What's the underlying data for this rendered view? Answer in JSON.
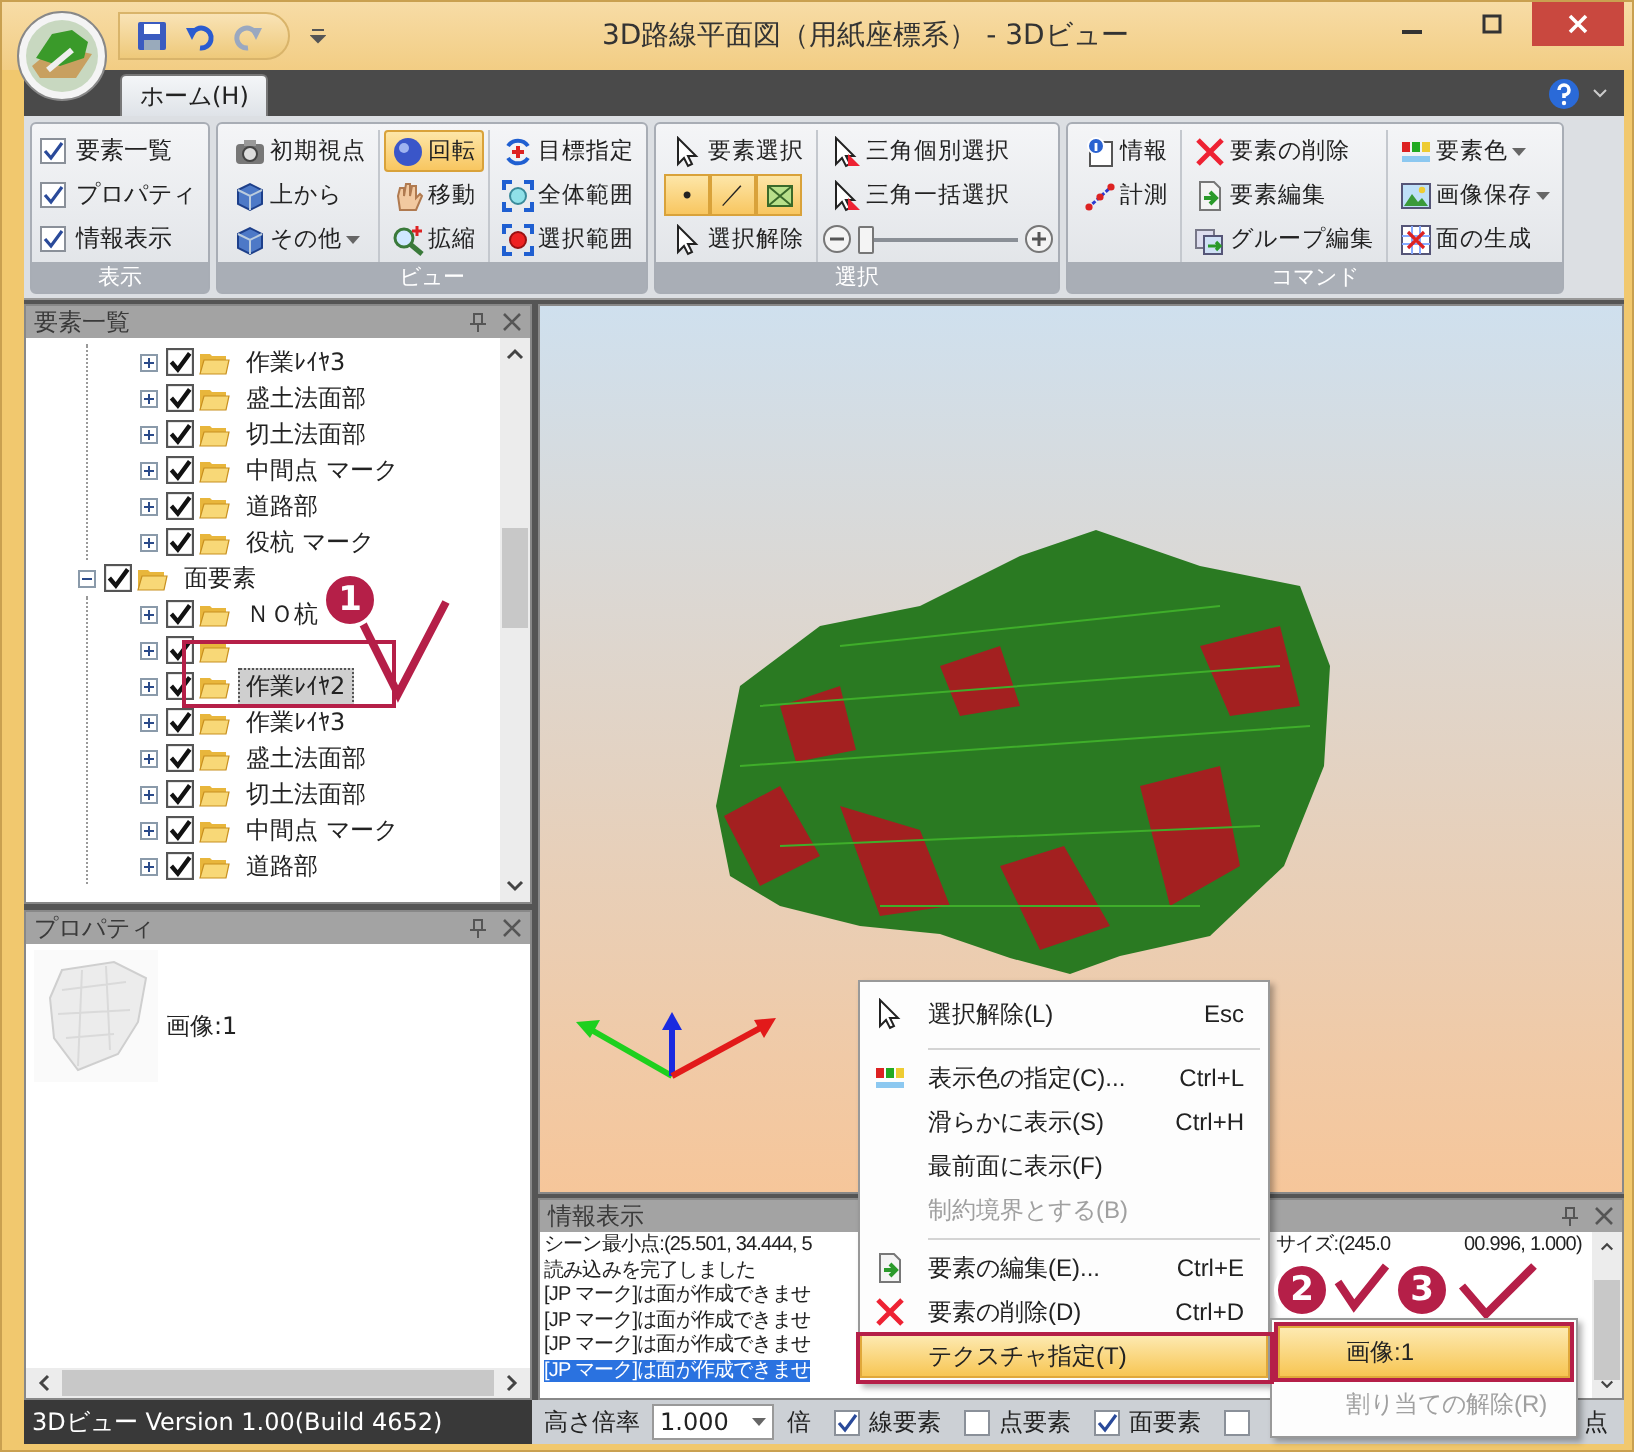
{
  "window": {
    "title": "3D路線平面図（用紙座標系） - 3Dビュー"
  },
  "tabs": [
    {
      "label": "ホーム(H)",
      "selected": true
    }
  ],
  "ribbon": {
    "groups": [
      {
        "title": "表示",
        "columns": [
          [
            {
              "kind": "check",
              "label": "要素一覧",
              "checked": true
            },
            {
              "kind": "check",
              "label": "プロパティ",
              "checked": true
            },
            {
              "kind": "check",
              "label": "情報表示",
              "checked": true
            }
          ]
        ]
      },
      {
        "title": "ビュー",
        "columns": [
          [
            {
              "kind": "button",
              "label": "初期視点",
              "selected": false
            },
            {
              "kind": "button",
              "label": "上から",
              "selected": false
            },
            {
              "kind": "button",
              "label": "その他",
              "selected": false,
              "dropdown": true
            }
          ],
          [
            {
              "kind": "button",
              "label": "回転",
              "selected": true
            },
            {
              "kind": "button",
              "label": "移動",
              "selected": false
            },
            {
              "kind": "button",
              "label": "拡縮",
              "selected": false
            }
          ],
          [
            {
              "kind": "button",
              "label": "目標指定",
              "selected": false
            },
            {
              "kind": "button",
              "label": "全体範囲",
              "selected": false
            },
            {
              "kind": "button",
              "label": "選択範囲",
              "selected": false
            }
          ]
        ]
      },
      {
        "title": "選択",
        "columns": [
          [
            {
              "kind": "button",
              "label": "要素選択",
              "selected": false
            },
            {
              "kind": "segments",
              "segments": [
                {
                  "label": "•",
                  "selected": true
                },
                {
                  "label": "／",
                  "selected": true
                },
                {
                  "selected": true
                }
              ]
            },
            {
              "kind": "button",
              "label": "選択解除",
              "selected": false
            }
          ],
          [
            {
              "kind": "button",
              "label": "三角個別選択",
              "selected": false
            },
            {
              "kind": "button",
              "label": "三角一括選択",
              "selected": false
            },
            {
              "kind": "slider",
              "level": 0
            }
          ]
        ]
      },
      {
        "title": "コマンド",
        "columns": [
          [
            {
              "kind": "button",
              "label": "情報",
              "selected": false
            },
            {
              "kind": "button",
              "label": "計測",
              "selected": false
            }
          ],
          [
            {
              "kind": "button",
              "label": "要素の削除",
              "selected": false
            },
            {
              "kind": "button",
              "label": "要素編集",
              "selected": false
            },
            {
              "kind": "button",
              "label": "グループ編集",
              "selected": false
            }
          ],
          [
            {
              "kind": "button",
              "label": "要素色",
              "selected": false,
              "dropdown": true
            },
            {
              "kind": "button",
              "label": "画像保存",
              "selected": false,
              "dropdown": true
            },
            {
              "kind": "button",
              "label": "面の生成",
              "selected": false
            }
          ]
        ]
      }
    ]
  },
  "element_panel": {
    "title": "要素一覧",
    "tree": [
      {
        "children": [
          {
            "label": "作業ﾚｲﾔ3",
            "checked": true,
            "expanded": false,
            "selected": false
          },
          {
            "label": "盛土法面部",
            "checked": true,
            "expanded": false,
            "selected": false
          },
          {
            "label": "切土法面部",
            "checked": true,
            "expanded": false,
            "selected": false
          },
          {
            "label": "中間点 マーク",
            "checked": true,
            "expanded": false,
            "selected": false
          },
          {
            "label": "道路部",
            "checked": true,
            "expanded": false,
            "selected": false
          },
          {
            "label": "役杭 マーク",
            "checked": true,
            "expanded": false,
            "selected": false
          }
        ]
      },
      {
        "label": "面要素",
        "checked": true,
        "expanded": true,
        "selected": false,
        "children": [
          {
            "label": "ＮＯ杭",
            "checked": true,
            "expanded": false,
            "selected": false
          },
          {
            "checked": true,
            "expanded": false
          },
          {
            "label": "作業ﾚｲﾔ2",
            "checked": true,
            "expanded": false,
            "selected": true
          },
          {
            "label": "作業ﾚｲﾔ3",
            "checked": true,
            "expanded": false,
            "selected": false
          },
          {
            "label": "盛土法面部",
            "checked": true,
            "expanded": false,
            "selected": false
          },
          {
            "label": "切土法面部",
            "checked": true,
            "expanded": false,
            "selected": false
          },
          {
            "label": "中間点 マーク",
            "checked": true,
            "expanded": false,
            "selected": false
          },
          {
            "label": "道路部",
            "checked": true,
            "expanded": false,
            "selected": false
          }
        ]
      }
    ]
  },
  "property_panel": {
    "title": "プロパティ",
    "image_label": "画像:1"
  },
  "info_panel": {
    "title": "情報表示",
    "lines": [
      {
        "text": "シーン最小点:(25.501, 34.444, 5",
        "tail": [
          "サイズ:(245.0",
          "00.996, 1.000)"
        ],
        "selected": false
      },
      {
        "text": "読み込みを完了しました",
        "selected": false
      },
      {
        "text": "[JP マーク]は面が作成できませ",
        "selected": false
      },
      {
        "text": "[JP マーク]は面が作成できませ",
        "selected": false
      },
      {
        "text": "[JP マーク]は面が作成できませ",
        "selected": false
      },
      {
        "text": "[JP マーク]は面が作成できませ",
        "selected": true
      }
    ]
  },
  "context_menu": {
    "items": [
      {
        "kind": "item",
        "label": "選択解除(L)",
        "shortcut": "Esc",
        "disabled": false,
        "selected": false
      },
      {
        "kind": "separator"
      },
      {
        "kind": "item",
        "label": "表示色の指定(C)...",
        "shortcut": "Ctrl+L",
        "disabled": false,
        "selected": false
      },
      {
        "kind": "item",
        "label": "滑らかに表示(S)",
        "shortcut": "Ctrl+H",
        "disabled": false,
        "selected": false
      },
      {
        "kind": "item",
        "label": "最前面に表示(F)",
        "disabled": false,
        "selected": false
      },
      {
        "kind": "item",
        "label": "制約境界とする(B)",
        "disabled": true,
        "selected": false
      },
      {
        "kind": "separator"
      },
      {
        "kind": "item",
        "label": "要素の編集(E)...",
        "shortcut": "Ctrl+E",
        "disabled": false,
        "selected": false
      },
      {
        "kind": "item",
        "label": "要素の削除(D)",
        "shortcut": "Ctrl+D",
        "disabled": false,
        "selected": false
      },
      {
        "kind": "item",
        "label": "テクスチャ指定(T)",
        "disabled": false,
        "selected": true
      }
    ]
  },
  "submenu": {
    "items": [
      {
        "label": "画像:1",
        "disabled": false,
        "selected": true
      },
      {
        "label": "割り当ての解除(R)",
        "disabled": true,
        "selected": false
      }
    ]
  },
  "status_bar": {
    "version": "3Dビュー Version 1.00(Build 4652)",
    "height_label": "高さ倍率",
    "height_value": "1.000",
    "unit": "倍",
    "options": [
      {
        "label": "線要素",
        "checked": true
      },
      {
        "label": "点要素",
        "checked": false
      },
      {
        "label": "面要素",
        "checked": true
      },
      {
        "checked": false
      }
    ],
    "trailing": "点"
  },
  "annotations": [
    {
      "number": "1"
    },
    {
      "number": "2"
    },
    {
      "number": "3"
    }
  ]
}
